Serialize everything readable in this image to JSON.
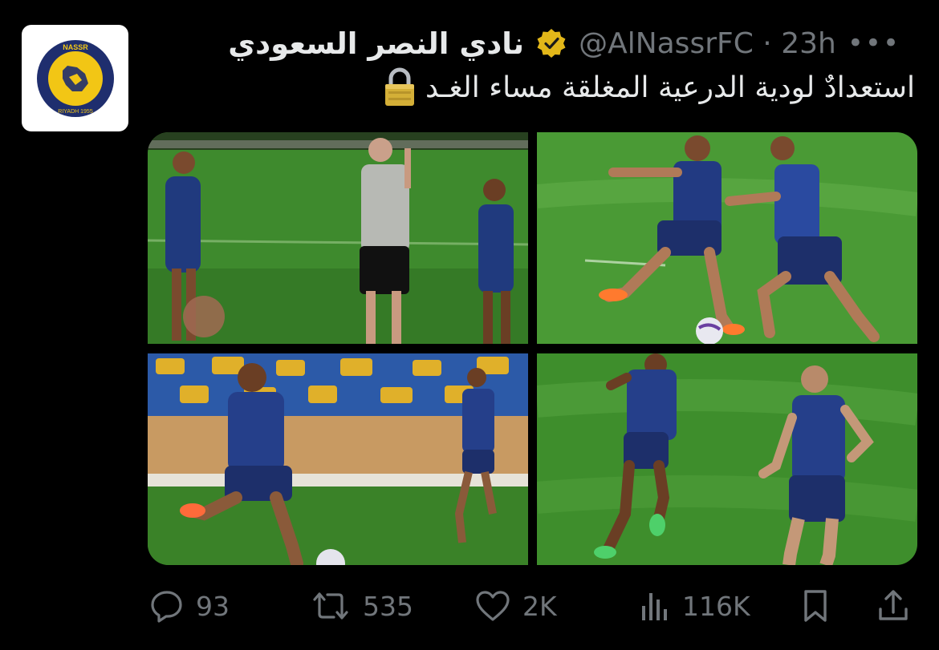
{
  "tweet": {
    "avatar": {
      "logo_top_text": "NASSR",
      "logo_bottom_text": "RIYADH 1955",
      "colors": {
        "navy": "#1f2e6e",
        "yellow": "#f2c615",
        "bg": "#ffffff"
      }
    },
    "display_name": "نادي النصر السعودي",
    "verified_icon": "gold-verified-badge-icon",
    "handle": "@AlNassrFC",
    "separator": "·",
    "time": "23h",
    "more_label": "•••",
    "text": "استعدادٌ لودية الدرعية المغلقة مساء الغـد",
    "text_icon": "lock-icon"
  },
  "media": {
    "photos": [
      {
        "name": "training-photo-players-and-coach"
      },
      {
        "name": "training-photo-two-players-ball"
      },
      {
        "name": "training-photo-player-running-stadium"
      },
      {
        "name": "training-photo-two-players-pitch"
      }
    ]
  },
  "actions": {
    "reply": {
      "icon": "reply-icon",
      "count": "93"
    },
    "retweet": {
      "icon": "retweet-icon",
      "count": "535"
    },
    "like": {
      "icon": "heart-icon",
      "count": "2K"
    },
    "views": {
      "icon": "views-chart-icon",
      "count": "116K"
    },
    "bookmark": {
      "icon": "bookmark-icon"
    },
    "share": {
      "icon": "share-icon"
    }
  },
  "colors": {
    "background": "#000000",
    "text": "#e7e9ea",
    "muted": "#71767b",
    "pitch": "#3f8a2e",
    "kit_navy": "#233a7a"
  }
}
